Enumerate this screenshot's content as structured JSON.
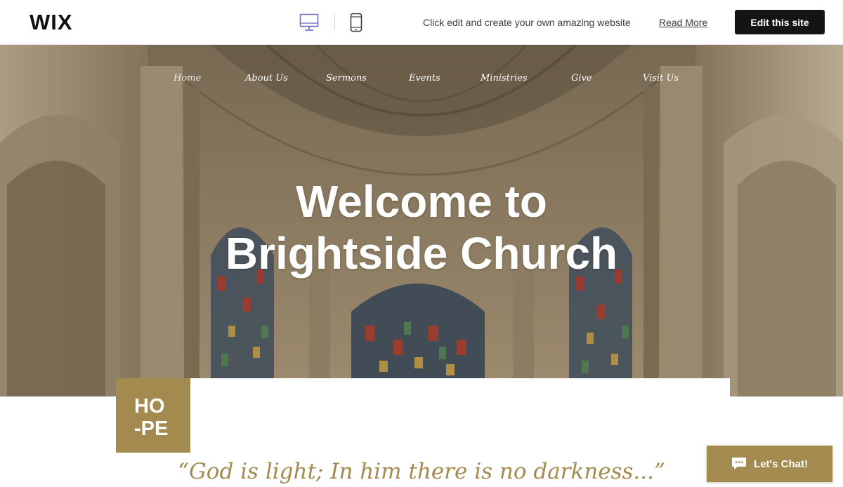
{
  "wix_bar": {
    "logo": "WIX",
    "promo_text": "Click edit and create your own amazing website",
    "read_more": "Read More",
    "edit_button": "Edit this site",
    "icons": {
      "desktop": "desktop-icon",
      "mobile": "mobile-icon"
    },
    "active_device_color": "#6b6ec8"
  },
  "site": {
    "nav": [
      "Home",
      "About Us",
      "Sermons",
      "Events",
      "Ministries",
      "Give",
      "Visit Us"
    ],
    "nav_active": "Home",
    "hero_title_line1": "Welcome to",
    "hero_title_line2": "Brightside Church",
    "hope_line1": "HO",
    "hope_line2": "-PE",
    "quote": "“God is light; In him there is no darkness...”",
    "chat_button": "Let's Chat!",
    "chat_icon": "chat-bubble-icon",
    "accent_color": "#a38a4f"
  }
}
